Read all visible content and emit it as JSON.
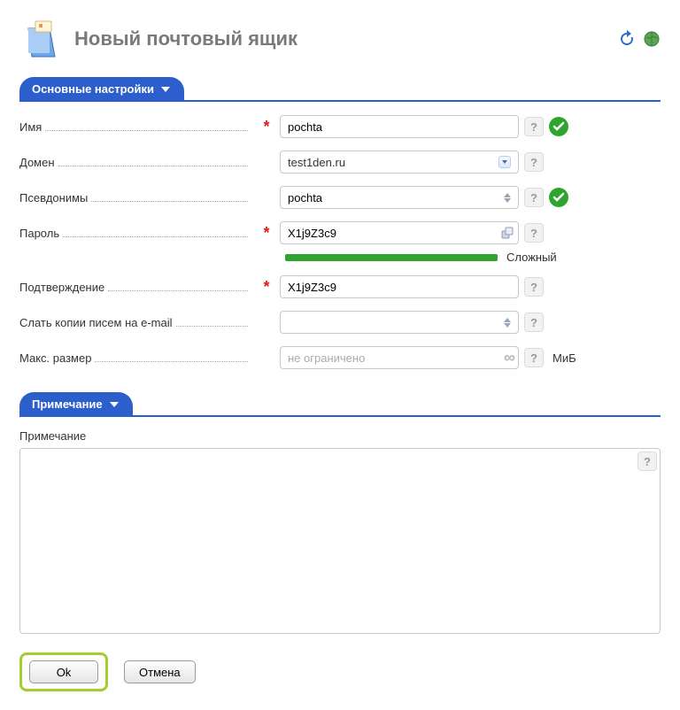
{
  "header": {
    "title": "Новый почтовый ящик"
  },
  "sections": {
    "main": "Основные настройки",
    "notes": "Примечание"
  },
  "labels": {
    "name": "Имя",
    "domain": "Домен",
    "aliases": "Псевдонимы",
    "password": "Пароль",
    "confirm": "Подтверждение",
    "copies": "Слать копии писем на e-mail",
    "maxsize": "Макс. размер",
    "notes_field": "Примечание"
  },
  "values": {
    "name": "pochta",
    "domain_selected": "test1den.ru",
    "aliases": "pochta",
    "password": "X1j9Z3c9",
    "confirm": "X1j9Z3c9",
    "copies": "",
    "maxsize": "",
    "notes": ""
  },
  "placeholders": {
    "maxsize": "не ограничено"
  },
  "password_strength": {
    "label": "Сложный"
  },
  "units": {
    "size": "МиБ"
  },
  "buttons": {
    "ok": "Ok",
    "cancel": "Отмена"
  },
  "icons": {
    "refresh": "refresh-icon",
    "globe": "globe-icon",
    "mailbox": "mailbox-icon"
  }
}
